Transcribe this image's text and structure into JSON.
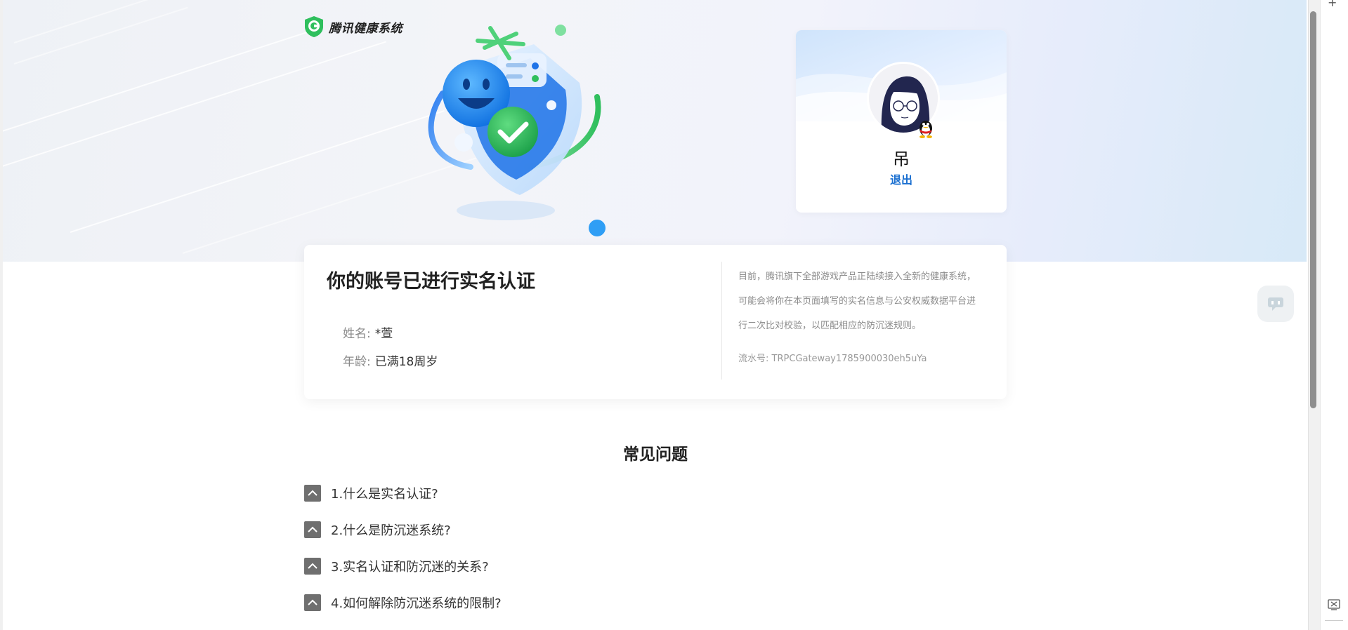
{
  "brand": {
    "name": "腾讯健康系统"
  },
  "user": {
    "name": "吊",
    "logout_label": "退出"
  },
  "verification": {
    "title": "你的账号已进行实名认证",
    "fields": [
      {
        "label": "姓名:",
        "value": "*萱"
      },
      {
        "label": "年龄:",
        "value": "已满18周岁"
      }
    ],
    "notice": "目前，腾讯旗下全部游戏产品正陆续接入全新的健康系统，可能会将你在本页面填写的实名信息与公安权威数据平台进行二次比对校验，以匹配相应的防沉迷规则。",
    "serial_label": "流水号:",
    "serial_value": "TRPCGateway1785900030eh5uYa"
  },
  "faq": {
    "title": "常见问题",
    "items": [
      "1.什么是实名认证?",
      "2.什么是防沉迷系统?",
      "3.实名认证和防沉迷的关系?",
      "4.如何解除防沉迷系统的限制?"
    ]
  },
  "colors": {
    "accent": "#1a6fd0",
    "shield_green": "#2fbf5d",
    "smiley_blue": "#1e8cf0"
  },
  "icons": {
    "logo": "green-shield-icon",
    "qq": "qq-penguin-icon",
    "faq_toggle": "chevron-up-icon",
    "float": "chat-bubble-icon",
    "browser_edge": "screenshot-icon"
  }
}
